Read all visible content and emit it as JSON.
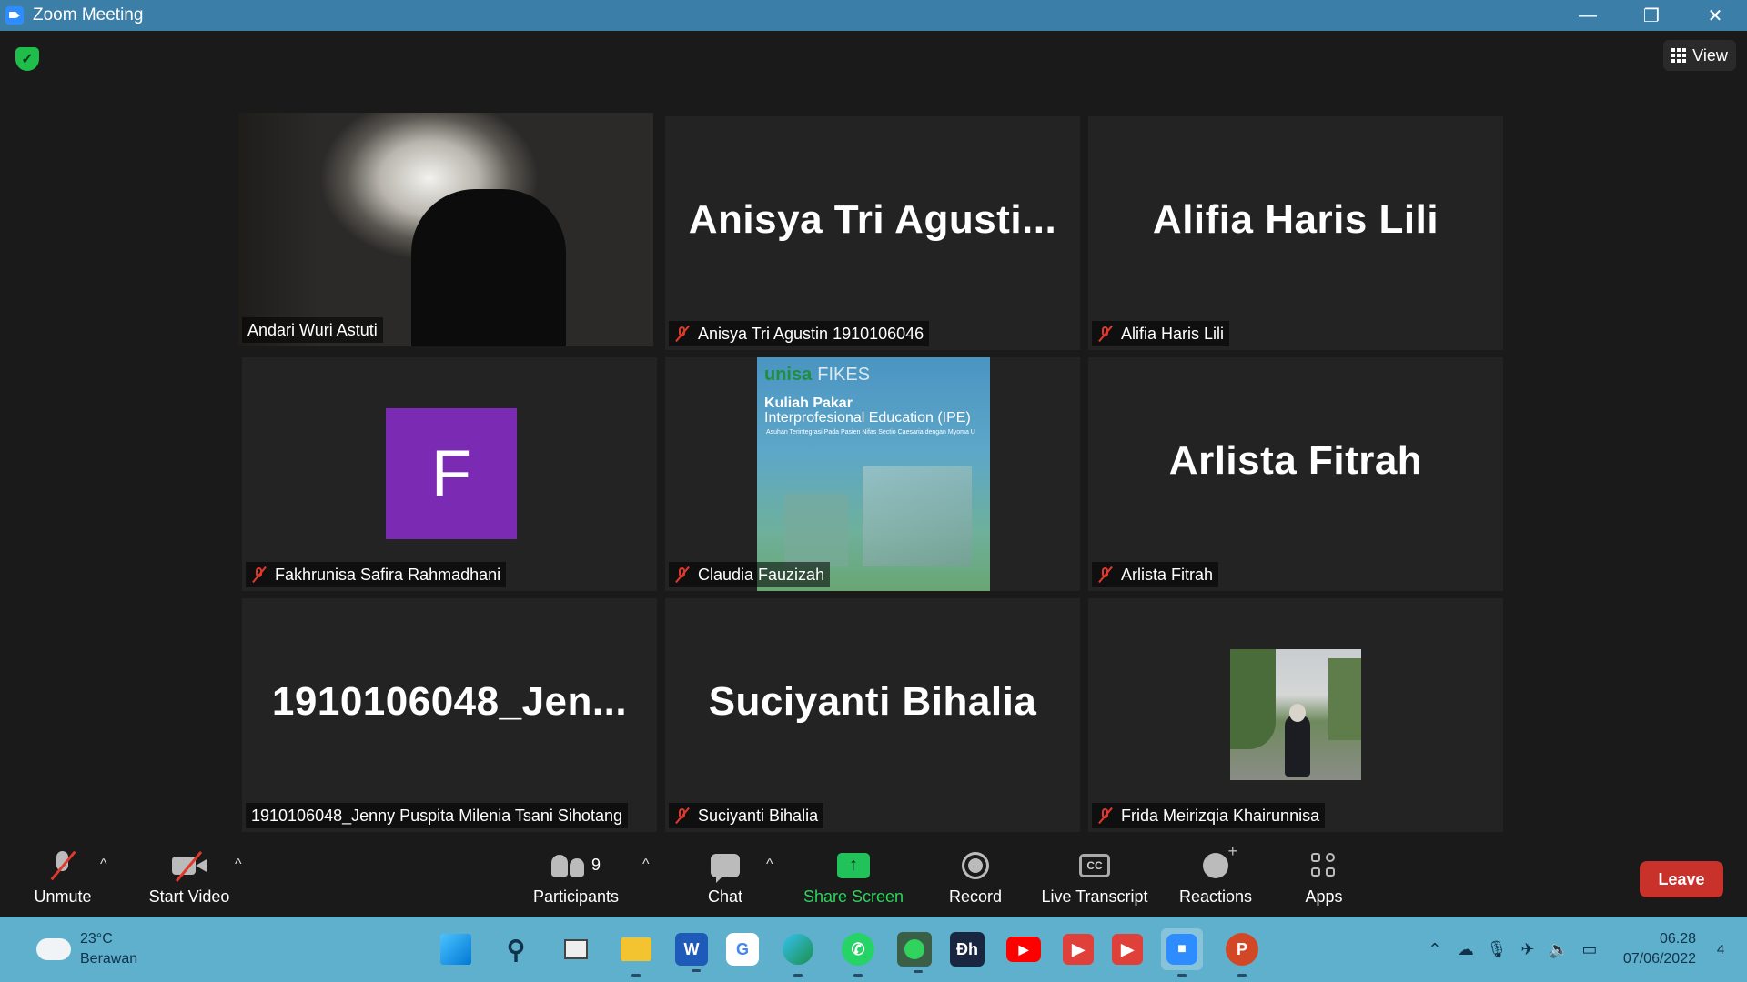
{
  "window": {
    "title": "Zoom Meeting",
    "minimize": "—",
    "restore": "❐",
    "close": "✕"
  },
  "topbar": {
    "view_label": "View",
    "security": "✓"
  },
  "tiles": [
    {
      "name": "Andari Wuri Astuti",
      "big": ""
    },
    {
      "name": "Anisya Tri Agustin 1910106046",
      "big": "Anisya Tri Agusti..."
    },
    {
      "name": "Alifia Haris Lili",
      "big": "Alifia Haris Lili"
    },
    {
      "name": "Fakhrunisa Safira Rahmadhani",
      "big": "",
      "avatar_letter": "F"
    },
    {
      "name": "Claudia Fauzizah",
      "big": "",
      "slide": {
        "logo": "unisa",
        "logo2": "FIKES",
        "title": "Kuliah Pakar",
        "subtitle": "Interprofesional Education (IPE)",
        "small": "Asuhan Terintegrasi Pada Pasien Nifas Sectio Caesaria dengan Myoma U"
      }
    },
    {
      "name": "Arlista Fitrah",
      "big": "Arlista Fitrah"
    },
    {
      "name": "1910106048_Jenny Puspita Milenia Tsani Sihotang",
      "big": "1910106048_Jen..."
    },
    {
      "name": "Suciyanti Bihalia",
      "big": "Suciyanti Bihalia"
    },
    {
      "name": "Frida Meirizqia Khairunnisa",
      "big": ""
    }
  ],
  "toolbar": {
    "unmute": "Unmute",
    "start_video": "Start Video",
    "participants": "Participants",
    "participants_count": "9",
    "chat": "Chat",
    "share_screen": "Share Screen",
    "record": "Record",
    "live_transcript": "Live Transcript",
    "cc": "CC",
    "reactions": "Reactions",
    "apps": "Apps",
    "leave": "Leave",
    "caret": "^"
  },
  "taskbar": {
    "temp": "23°C",
    "weather": "Berawan",
    "time": "06.28",
    "date": "07/06/2022",
    "notifications": "4",
    "apps": [
      "windows-start",
      "search",
      "task-view",
      "file-explorer",
      "word",
      "google",
      "edge",
      "whatsapp",
      "green-app",
      "dh-app",
      "youtube",
      "red-app-1",
      "red-app-2",
      "zoom",
      "powerpoint"
    ]
  }
}
